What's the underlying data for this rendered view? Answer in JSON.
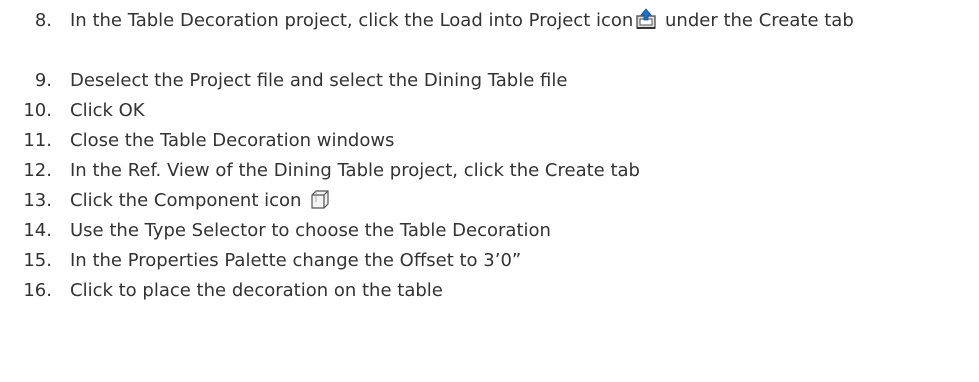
{
  "steps": [
    {
      "num": "8.",
      "before": "In the Table Decoration project, click the Load into Project icon",
      "icon": "load-into-project-icon",
      "after": " under the Create tab"
    },
    {
      "num": "9.",
      "text": "Deselect the Project file and select the Dining Table file"
    },
    {
      "num": "10.",
      "text": "Click OK"
    },
    {
      "num": "11.",
      "text": "Close the Table Decoration windows"
    },
    {
      "num": "12.",
      "text": "In the Ref. View of the Dining Table project, click the Create tab"
    },
    {
      "num": "13.",
      "before": "Click the Component icon",
      "icon": "component-icon",
      "after": ""
    },
    {
      "num": "14.",
      "text": "Use the Type Selector to choose the Table Decoration"
    },
    {
      "num": "15.",
      "text": "In the Properties Palette change the Offset to 3’0”"
    },
    {
      "num": "16.",
      "text": "Click to place the decoration on the table"
    }
  ]
}
